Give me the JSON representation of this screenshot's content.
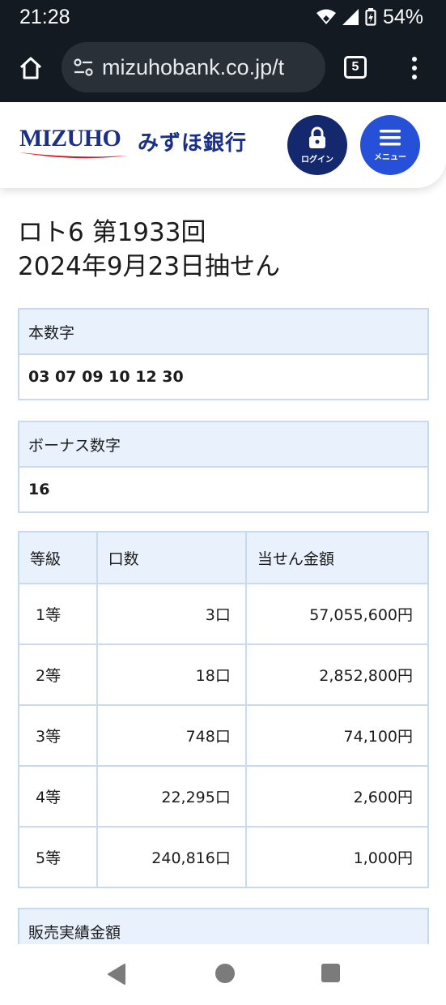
{
  "status_bar": {
    "time": "21:28",
    "battery": "54%"
  },
  "browser": {
    "url": "mizuhobank.co.jp/t",
    "tab_count": "5"
  },
  "site": {
    "logo_en": "MIZUHO",
    "logo_jp": "みずほ銀行",
    "login_label": "ログイン",
    "menu_label": "メニュー"
  },
  "page": {
    "title_line1": "ロト6 第1933回",
    "title_line2": "2024年9月23日抽せん"
  },
  "main_numbers": {
    "header": "本数字",
    "value": "03 07 09 10 12 30"
  },
  "bonus_number": {
    "header": "ボーナス数字",
    "value": "16"
  },
  "prize_table": {
    "headers": [
      "等級",
      "口数",
      "当せん金額"
    ],
    "rows": [
      {
        "rank": "1等",
        "count": "3口",
        "amount": "57,055,600円"
      },
      {
        "rank": "2等",
        "count": "18口",
        "amount": "2,852,800円"
      },
      {
        "rank": "3等",
        "count": "748口",
        "amount": "74,100円"
      },
      {
        "rank": "4等",
        "count": "22,295口",
        "amount": "2,600円"
      },
      {
        "rank": "5等",
        "count": "240,816口",
        "amount": "1,000円"
      }
    ]
  },
  "sales_section": {
    "header": "販売実績金額"
  }
}
